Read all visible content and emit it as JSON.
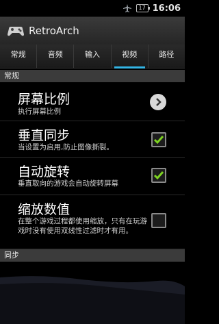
{
  "status_bar": {
    "battery_text": "17",
    "time": "16:06",
    "icons": [
      "airplane-icon",
      "battery-icon"
    ]
  },
  "app": {
    "title": "RetroArch"
  },
  "tabs": [
    {
      "label": "常规",
      "active": false
    },
    {
      "label": "音频",
      "active": false
    },
    {
      "label": "输入",
      "active": false
    },
    {
      "label": "视频",
      "active": true
    },
    {
      "label": "路径",
      "active": false
    }
  ],
  "sections": {
    "general": "常规",
    "sync": "同步"
  },
  "settings": {
    "aspect_ratio": {
      "title": "屏幕比例",
      "summary": "执行屏幕比例"
    },
    "vsync": {
      "title": "垂直同步",
      "summary": "当设置为启用,防止图像撕裂。",
      "checked": true
    },
    "auto_rotate": {
      "title": "自动旋转",
      "summary": "垂直取向的游戏会自动旋转屏幕",
      "checked": true
    },
    "scaling": {
      "title": "缩放数值",
      "summary": "在整个游戏过程都使用缩放，只有在玩游戏时没有使用双线性过滤时才有用。",
      "checked": false
    }
  },
  "colors": {
    "accent": "#33b5e5",
    "check": "#7ed321"
  }
}
